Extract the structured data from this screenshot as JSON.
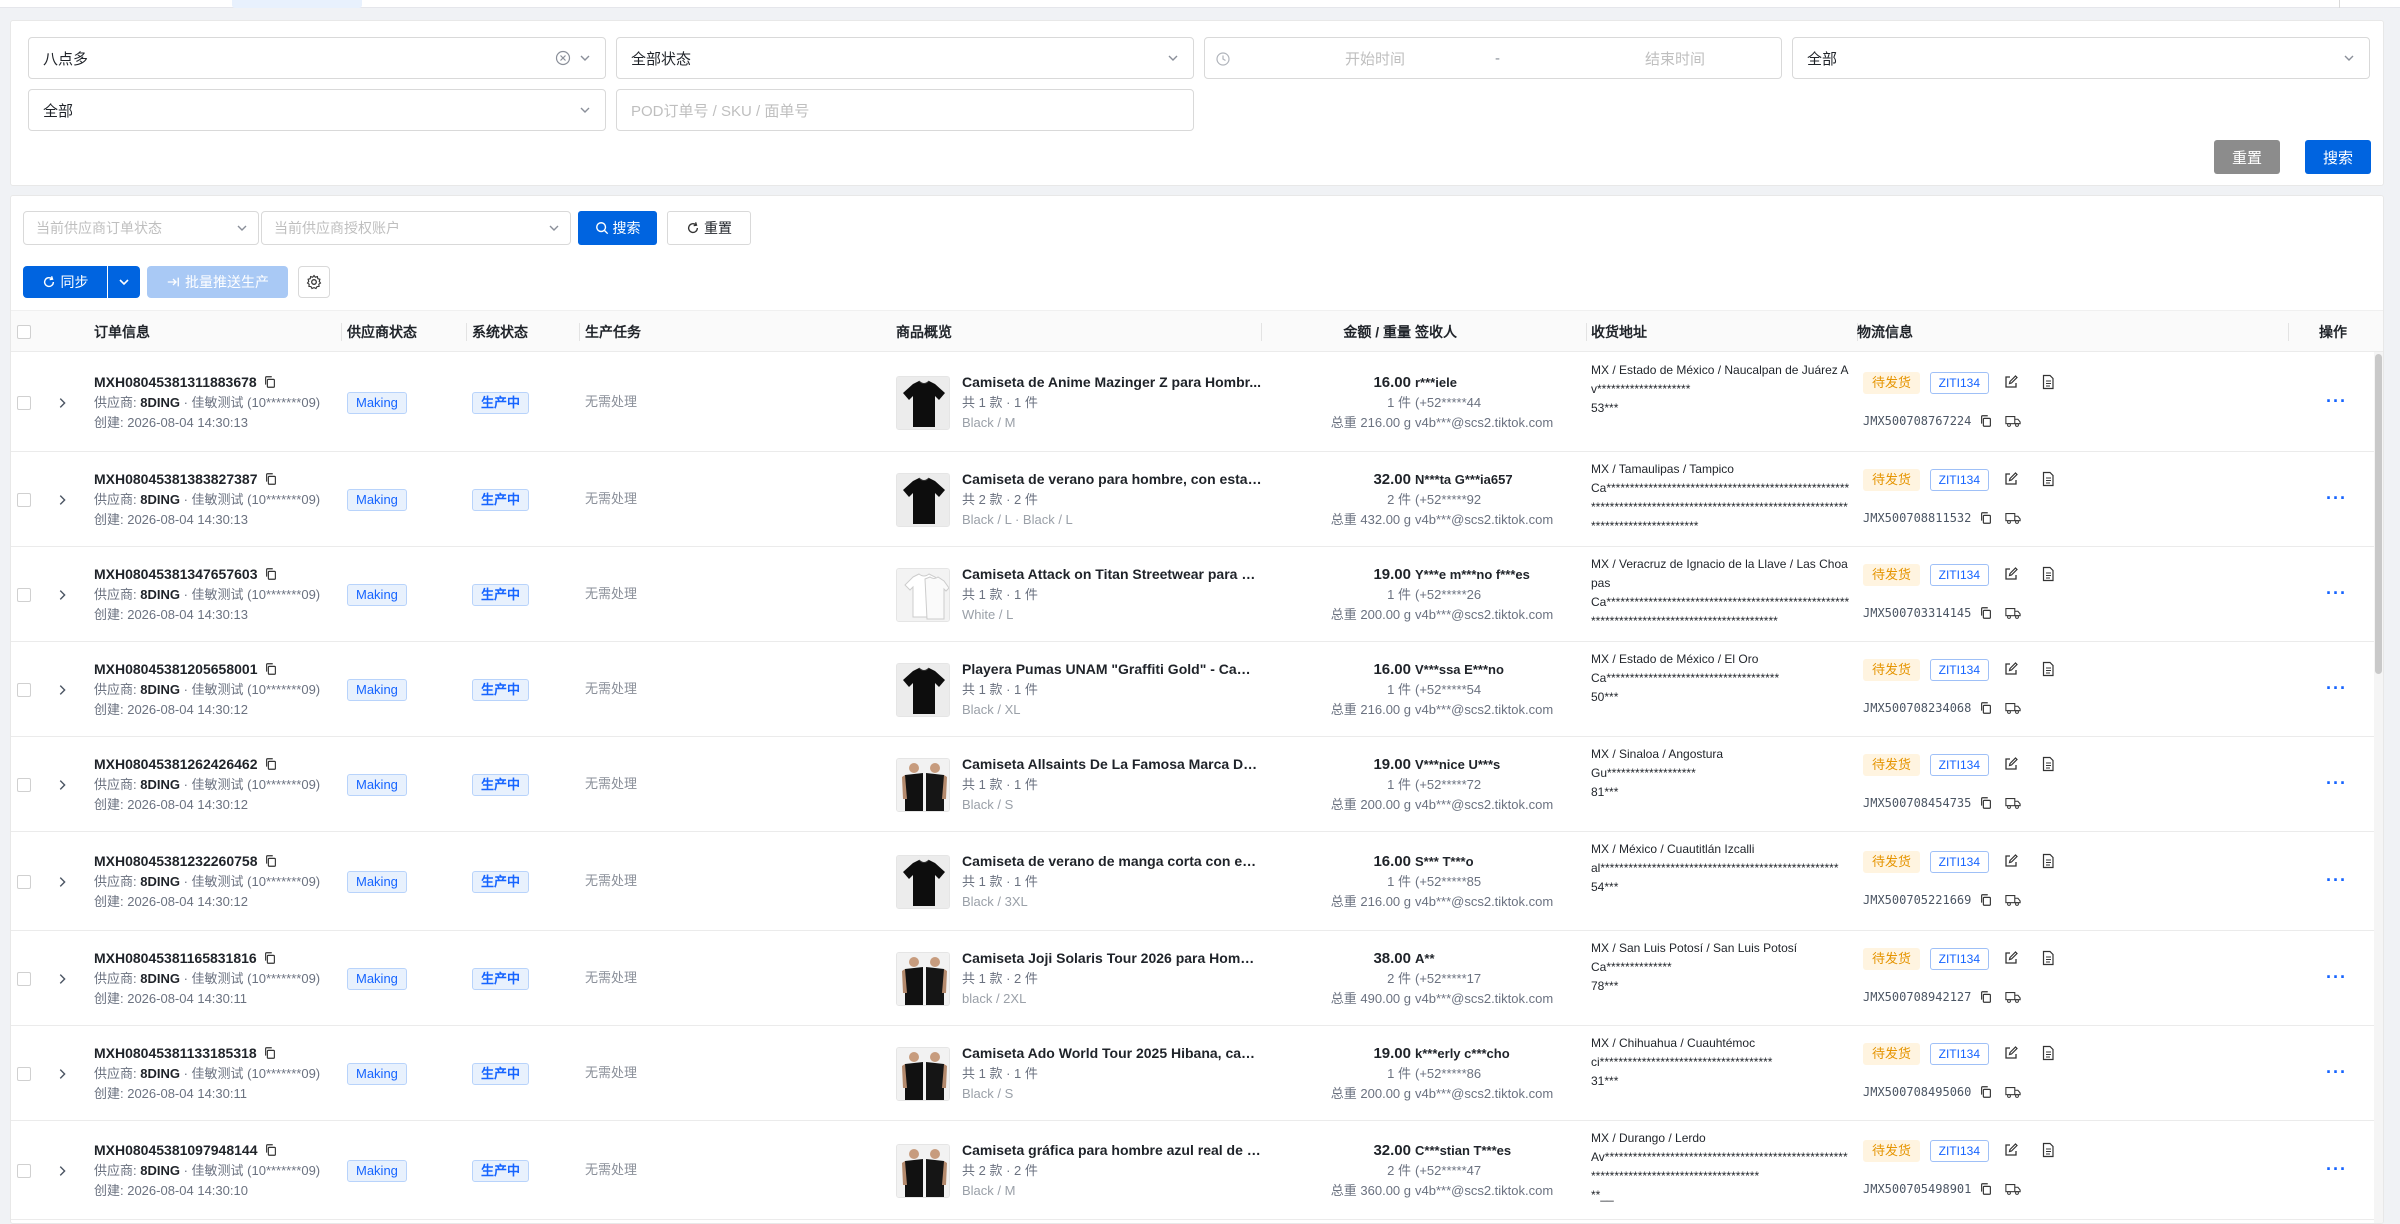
{
  "filters": {
    "shop": {
      "value": "八点多"
    },
    "status": {
      "value": "全部状态"
    },
    "start_time": {
      "placeholder": "开始时间"
    },
    "time_sep": "-",
    "end_time": {
      "placeholder": "结束时间"
    },
    "select_right": {
      "value": "全部"
    },
    "select_second": {
      "value": "全部"
    },
    "search_input": {
      "placeholder": "POD订单号 / SKU / 面单号"
    },
    "reset_label": "重置",
    "search_label": "搜索"
  },
  "list_toolbar": {
    "supplier_status": {
      "placeholder": "当前供应商订单状态"
    },
    "supplier_account": {
      "placeholder": "当前供应商授权账户"
    },
    "search_label": "搜索",
    "reset_label": "重置",
    "sync_label": "同步",
    "batch_label": "批量推送生产"
  },
  "table": {
    "columns": {
      "order": "订单信息",
      "supplier_status": "供应商状态",
      "system_status": "系统状态",
      "production": "生产任务",
      "product": "商品概览",
      "amount": "金额 / 重量",
      "receiver": "签收人",
      "address": "收货地址",
      "logistics": "物流信息",
      "ops": "操作"
    },
    "rows": [
      {
        "id": "MXH08045381311883678",
        "supplier_prefix": "供应商:",
        "supplier_name": "8DING",
        "supplier_rest": " · 佳敏测试 (10*******09)",
        "created": "创建: 2026-08-04 14:30:13",
        "supplier_status": "Making",
        "system_status": "生产中",
        "production": "无需处理",
        "product_name": "Camiseta de Anime Mazinger Z para Hombr...",
        "product_qty": "共 1 款 · 1 件",
        "product_variant": "Black / M",
        "amount": "16.00",
        "pieces": "1 件",
        "weight": "总重 216.00 g",
        "receiver": "r***iele",
        "phone": "(+52*****44",
        "email": "v4b***@scs2.tiktok.com",
        "address": "MX / Estado de México / Naucalpan de Juárez Av********************<br>53***",
        "ship_status": "待发货",
        "ziti": "ZITI134",
        "tracking": "JMX500708767224",
        "shirt": "black"
      },
      {
        "id": "MXH08045381383827387",
        "supplier_prefix": "供应商:",
        "supplier_name": "8DING",
        "supplier_rest": " · 佳敏测试 (10*******09)",
        "created": "创建: 2026-08-04 14:30:13",
        "supplier_status": "Making",
        "system_status": "生产中",
        "production": "无需处理",
        "product_name": "Camiseta de verano para hombre, con estam...",
        "product_qty": "共 2 款 · 2 件",
        "product_variant": "Black / L · Black / L",
        "amount": "32.00",
        "pieces": "2 件",
        "weight": "总重 432.00 g",
        "receiver": "N***ta G***ia657",
        "phone": "(+52*****92",
        "email": "v4b***@scs2.tiktok.com",
        "address": "MX / Tamaulipas / Tampico<br>Ca**********************************************************************************************************************************",
        "ship_status": "待发货",
        "ziti": "ZITI134",
        "tracking": "JMX500708811532",
        "shirt": "black"
      },
      {
        "id": "MXH08045381347657603",
        "supplier_prefix": "供应商:",
        "supplier_name": "8DING",
        "supplier_rest": " · 佳敏测试 (10*******09)",
        "created": "创建: 2026-08-04 14:30:13",
        "supplier_status": "Making",
        "system_status": "生产中",
        "production": "无需处理",
        "product_name": "Camiseta Attack on Titan Streetwear para ho...",
        "product_qty": "共 1 款 · 1 件",
        "product_variant": "White / L",
        "amount": "19.00",
        "pieces": "1 件",
        "weight": "总重 200.00 g",
        "receiver": "Y***e m***no f***es",
        "phone": "(+52*****26",
        "email": "v4b***@scs2.tiktok.com",
        "address": "MX / Veracruz de Ignacio de la Llave / Las Choapas<br>Ca********************************************************************************************",
        "ship_status": "待发货",
        "ziti": "ZITI134",
        "tracking": "JMX500703314145",
        "shirt": "white"
      },
      {
        "id": "MXH08045381205658001",
        "supplier_prefix": "供应商:",
        "supplier_name": "8DING",
        "supplier_rest": " · 佳敏测试 (10*******09)",
        "created": "创建: 2026-08-04 14:30:12",
        "supplier_status": "Making",
        "system_status": "生产中",
        "production": "无需处理",
        "product_name": "Playera Pumas UNAM \"Graffiti Gold\" - Cami...",
        "product_qty": "共 1 款 · 1 件",
        "product_variant": "Black / XL",
        "amount": "16.00",
        "pieces": "1 件",
        "weight": "总重 216.00 g",
        "receiver": "V***ssa E***no",
        "phone": "(+52*****54",
        "email": "v4b***@scs2.tiktok.com",
        "address": "MX / Estado de México / El Oro<br>Ca*************************************<br>50***",
        "ship_status": "待发货",
        "ziti": "ZITI134",
        "tracking": "JMX500708234068",
        "shirt": "black"
      },
      {
        "id": "MXH08045381262426462",
        "supplier_prefix": "供应商:",
        "supplier_name": "8DING",
        "supplier_rest": " · 佳敏测试 (10*******09)",
        "created": "创建: 2026-08-04 14:30:12",
        "supplier_status": "Making",
        "system_status": "生产中",
        "production": "无需处理",
        "product_name": "Camiseta Allsaints De La Famosa Marca De ...",
        "product_qty": "共 1 款 · 1 件",
        "product_variant": "Black / S",
        "amount": "19.00",
        "pieces": "1 件",
        "weight": "总重 200.00 g",
        "receiver": "V***nice U***s",
        "phone": "(+52*****72",
        "email": "v4b***@scs2.tiktok.com",
        "address": "MX / Sinaloa / Angostura<br>Gu*******************<br>81***",
        "ship_status": "待发货",
        "ziti": "ZITI134",
        "tracking": "JMX500708454735",
        "shirt": "model"
      },
      {
        "id": "MXH08045381232260758",
        "supplier_prefix": "供应商:",
        "supplier_name": "8DING",
        "supplier_rest": " · 佳敏测试 (10*******09)",
        "created": "创建: 2026-08-04 14:30:12",
        "supplier_status": "Making",
        "system_status": "生产中",
        "production": "无需处理",
        "product_name": "Camiseta de verano de manga corta con est...",
        "product_qty": "共 1 款 · 1 件",
        "product_variant": "Black / 3XL",
        "amount": "16.00",
        "pieces": "1 件",
        "weight": "总重 216.00 g",
        "receiver": "S*** T***o",
        "phone": "(+52*****85",
        "email": "v4b***@scs2.tiktok.com",
        "address": "MX / México / Cuautitlán Izcalli<br>al***************************************************<br>54***",
        "ship_status": "待发货",
        "ziti": "ZITI134",
        "tracking": "JMX500705221669",
        "shirt": "black"
      },
      {
        "id": "MXH08045381165831816",
        "supplier_prefix": "供应商:",
        "supplier_name": "8DING",
        "supplier_rest": " · 佳敏测试 (10*******09)",
        "created": "创建: 2026-08-04 14:30:11",
        "supplier_status": "Making",
        "system_status": "生产中",
        "production": "无需处理",
        "product_name": "Camiseta Joji Solaris Tour 2026 para Hombr...",
        "product_qty": "共 1 款 · 2 件",
        "product_variant": "black / 2XL",
        "amount": "38.00",
        "pieces": "2 件",
        "weight": "总重 490.00 g",
        "receiver": "A**",
        "phone": "(+52*****17",
        "email": "v4b***@scs2.tiktok.com",
        "address": "MX / San Luis Potosí / San Luis Potosí<br>Ca**************<br>78***",
        "ship_status": "待发货",
        "ziti": "ZITI134",
        "tracking": "JMX500708942127",
        "shirt": "model"
      },
      {
        "id": "MXH08045381133185318",
        "supplier_prefix": "供应商:",
        "supplier_name": "8DING",
        "supplier_rest": " · 佳敏测试 (10*******09)",
        "created": "创建: 2026-08-04 14:30:11",
        "supplier_status": "Making",
        "system_status": "生产中",
        "production": "无需处理",
        "product_name": "Camiseta Ado World Tour 2025 Hibana, cami...",
        "product_qty": "共 1 款 · 1 件",
        "product_variant": "Black / S",
        "amount": "19.00",
        "pieces": "1 件",
        "weight": "总重 200.00 g",
        "receiver": "k***erly c***cho",
        "phone": "(+52*****86",
        "email": "v4b***@scs2.tiktok.com",
        "address": "MX / Chihuahua / Cuauhtémoc<br>ci*************************************<br>31***",
        "ship_status": "待发货",
        "ziti": "ZITI134",
        "tracking": "JMX500708495060",
        "shirt": "model"
      },
      {
        "id": "MXH08045381097948144",
        "supplier_prefix": "供应商:",
        "supplier_name": "8DING",
        "supplier_rest": " · 佳敏测试 (10*******09)",
        "created": "创建: 2026-08-04 14:30:10",
        "supplier_status": "Making",
        "system_status": "生产中",
        "production": "无需处理",
        "product_name": "Camiseta gráfica para hombre azul real de b...",
        "product_qty": "共 2 款 · 2 件",
        "product_variant": "Black / M",
        "amount": "32.00",
        "pieces": "2 件",
        "weight": "总重 360.00 g",
        "receiver": "C***stian T***es",
        "phone": "(+52*****47",
        "email": "v4b***@scs2.tiktok.com",
        "address": "MX / Durango / Lerdo<br>Av****************************************************************************************<br>**__",
        "ship_status": "待发货",
        "ziti": "ZITI134",
        "tracking": "JMX500705498901",
        "shirt": "model"
      }
    ]
  },
  "icons": {
    "clear": "clear-icon",
    "chevron": "chevron-down-icon",
    "clock": "clock-icon",
    "search": "search-icon",
    "refresh": "refresh-icon",
    "send": "send-icon",
    "gear": "gear-icon",
    "copy": "copy-icon",
    "edit": "edit-icon",
    "doc": "document-icon",
    "truck": "truck-icon",
    "expand": "chevron-right-icon"
  },
  "colors": {
    "accent": "#0064e0",
    "tag_blue": "#1664ff",
    "warn": "#e59400"
  }
}
